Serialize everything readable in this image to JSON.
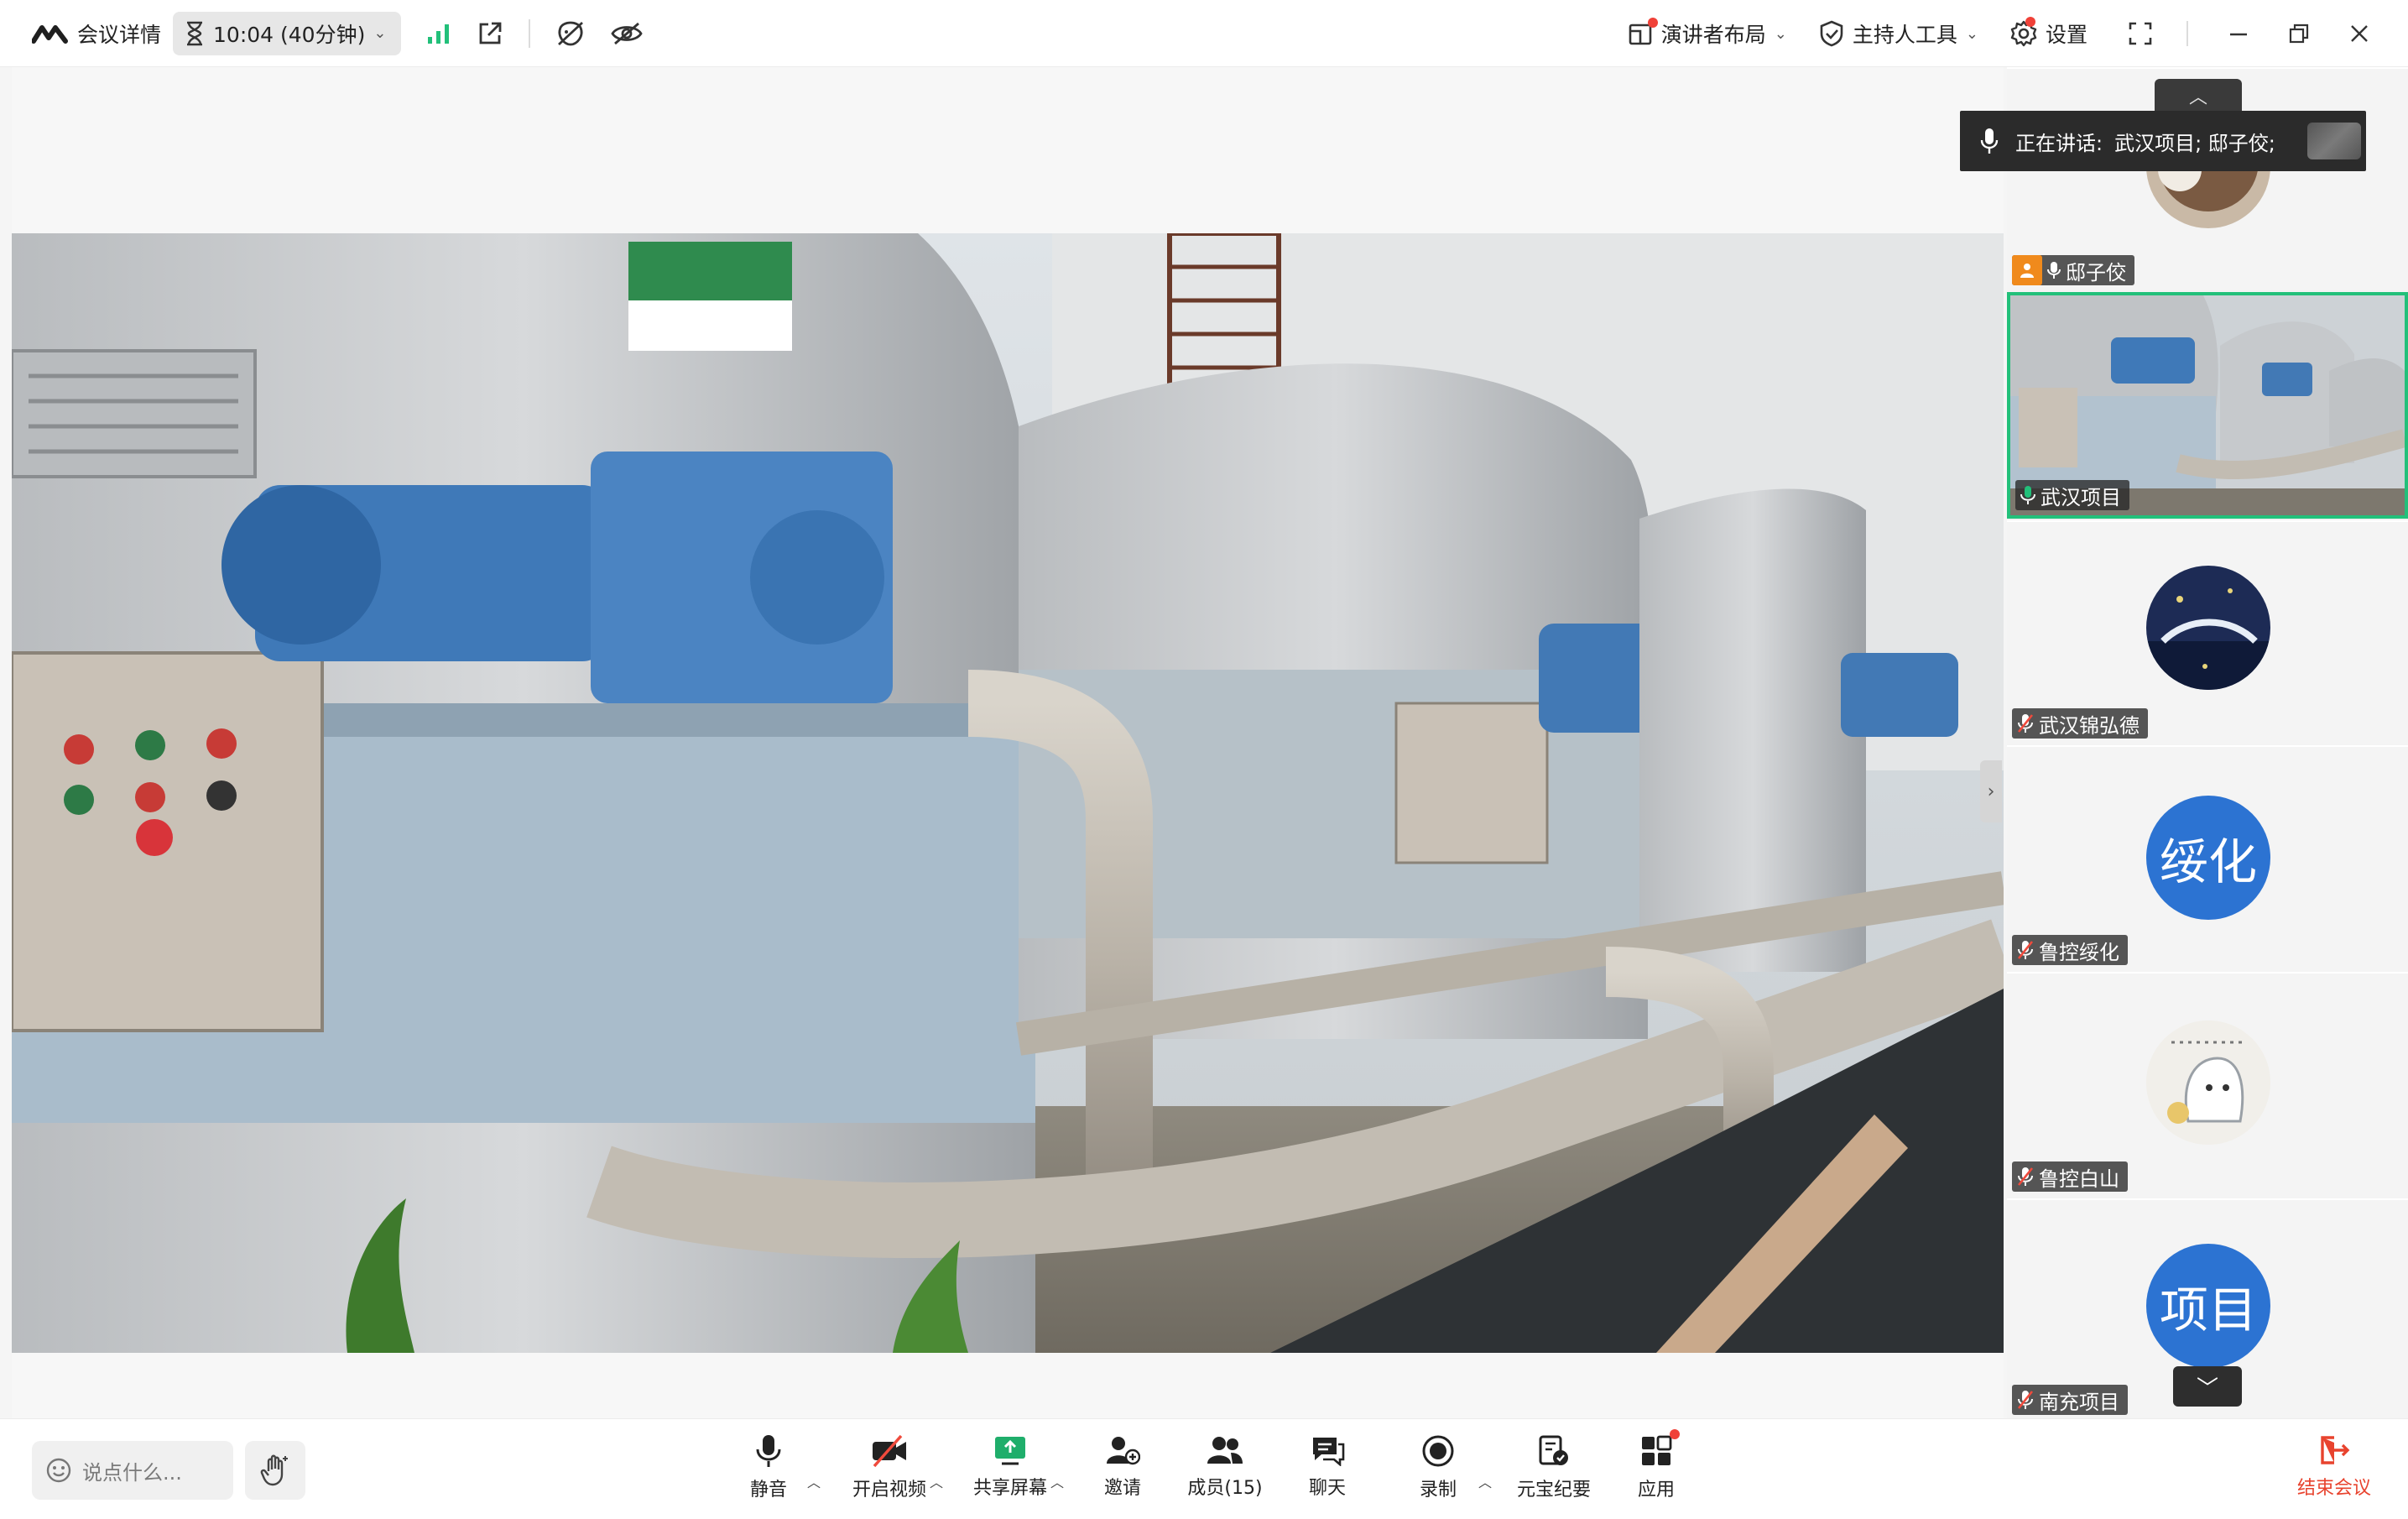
{
  "topbar": {
    "meeting_details": "会议详情",
    "timer": "10:04 (40分钟)",
    "layout_menu": "演讲者布局",
    "host_tools_menu": "主持人工具",
    "settings": "设置"
  },
  "speaking": {
    "label": "正在讲话:",
    "speakers": "武汉项目; 邸子佼;"
  },
  "participants": [
    {
      "name": "邸子佼",
      "role": "host",
      "avatar": "photo"
    },
    {
      "name": "武汉项目",
      "avatar": "video",
      "active": true
    },
    {
      "name": "武汉锦弘德",
      "avatar": "photo"
    },
    {
      "name": "鲁控绥化",
      "avatar_text": "绥化"
    },
    {
      "name": "鲁控白山",
      "avatar": "sticker"
    },
    {
      "name": "南充项目",
      "avatar_text": "项目"
    }
  ],
  "bottombar": {
    "chat_placeholder": "说点什么...",
    "tools": [
      {
        "id": "mute",
        "label": "静音"
      },
      {
        "id": "video",
        "label": "开启视频"
      },
      {
        "id": "share",
        "label": "共享屏幕"
      },
      {
        "id": "invite",
        "label": "邀请"
      },
      {
        "id": "members",
        "label": "成员(15)"
      },
      {
        "id": "chat",
        "label": "聊天"
      },
      {
        "id": "record",
        "label": "录制"
      },
      {
        "id": "summary",
        "label": "元宝纪要"
      },
      {
        "id": "apps",
        "label": "应用"
      }
    ],
    "end_meeting": "结束会议"
  },
  "colors": {
    "accent_green": "#22c07a",
    "avatar_blue": "#2c73d2",
    "end_red": "#e8432e",
    "host_orange": "#f08a1c"
  },
  "icons": {
    "brand": "tencent-meeting-logo-icon",
    "timer": "hourglass-icon",
    "signal": "signal-bars-icon",
    "popout": "external-window-icon",
    "beauty_off": "face-slash-icon",
    "hide": "eye-slash-icon",
    "layout": "layout-icon",
    "shield": "shield-icon",
    "settings": "gear-icon",
    "fullscreen": "fullscreen-icon",
    "mic": "mic-icon",
    "hand": "raise-hand-icon"
  }
}
